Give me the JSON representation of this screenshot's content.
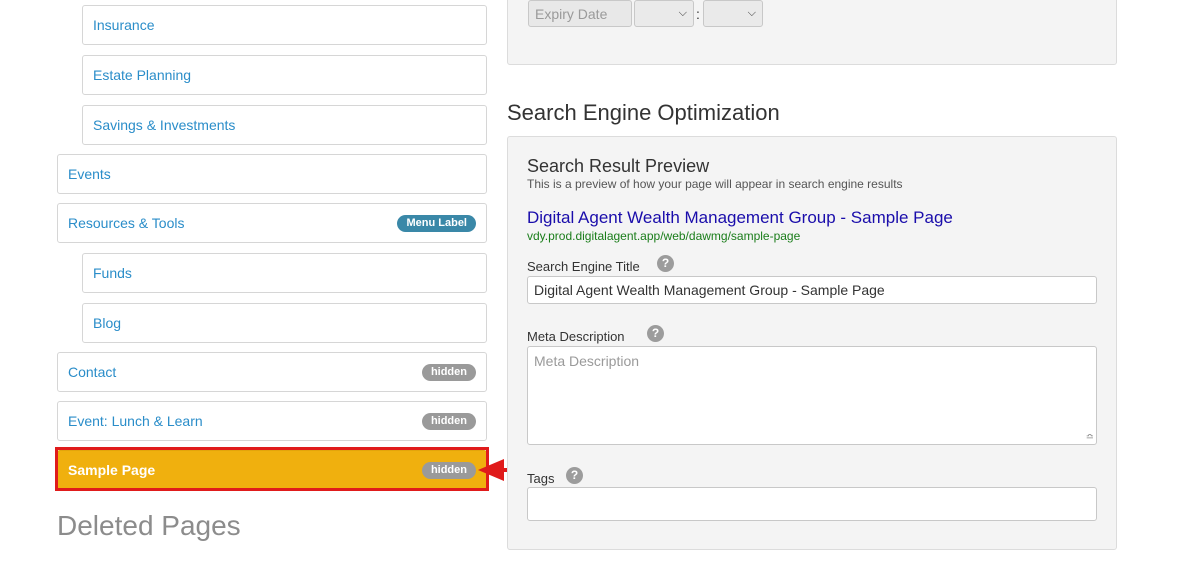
{
  "nav": {
    "items": [
      {
        "label": "Insurance",
        "level": "sub"
      },
      {
        "label": "Estate Planning",
        "level": "sub"
      },
      {
        "label": "Savings & Investments",
        "level": "sub"
      },
      {
        "label": "Events",
        "level": "top"
      },
      {
        "label": "Resources & Tools",
        "level": "top",
        "badge": "Menu Label"
      },
      {
        "label": "Funds",
        "level": "sub"
      },
      {
        "label": "Blog",
        "level": "sub"
      },
      {
        "label": "Contact",
        "level": "top",
        "badge": "hidden"
      },
      {
        "label": "Event: Lunch & Learn",
        "level": "top",
        "badge": "hidden"
      },
      {
        "label": "Sample Page",
        "level": "top",
        "badge": "hidden",
        "active": true
      }
    ],
    "deleted_title": "Deleted Pages"
  },
  "publish": {
    "expiry_placeholder": "Expiry Date",
    "colon": ":"
  },
  "seo": {
    "heading": "Search Engine Optimization",
    "preview_label": "Search Result Preview",
    "preview_help": "This is a preview of how your page will appear in search engine results",
    "preview_title": "Digital Agent Wealth Management Group - Sample Page",
    "preview_url": "vdy.prod.digitalagent.app/web/dawmg/sample-page",
    "title_label": "Search Engine Title",
    "title_value": "Digital Agent Wealth Management Group - Sample Page",
    "meta_label": "Meta Description",
    "meta_placeholder": "Meta Description",
    "tags_label": "Tags",
    "tags_value": "",
    "help_glyph": "?"
  },
  "colors": {
    "link": "#2a8dc9",
    "active": "#f0b00e",
    "highlight": "#e01b1b",
    "preview_title": "#1a0dab",
    "preview_url": "#1a7d1a"
  }
}
